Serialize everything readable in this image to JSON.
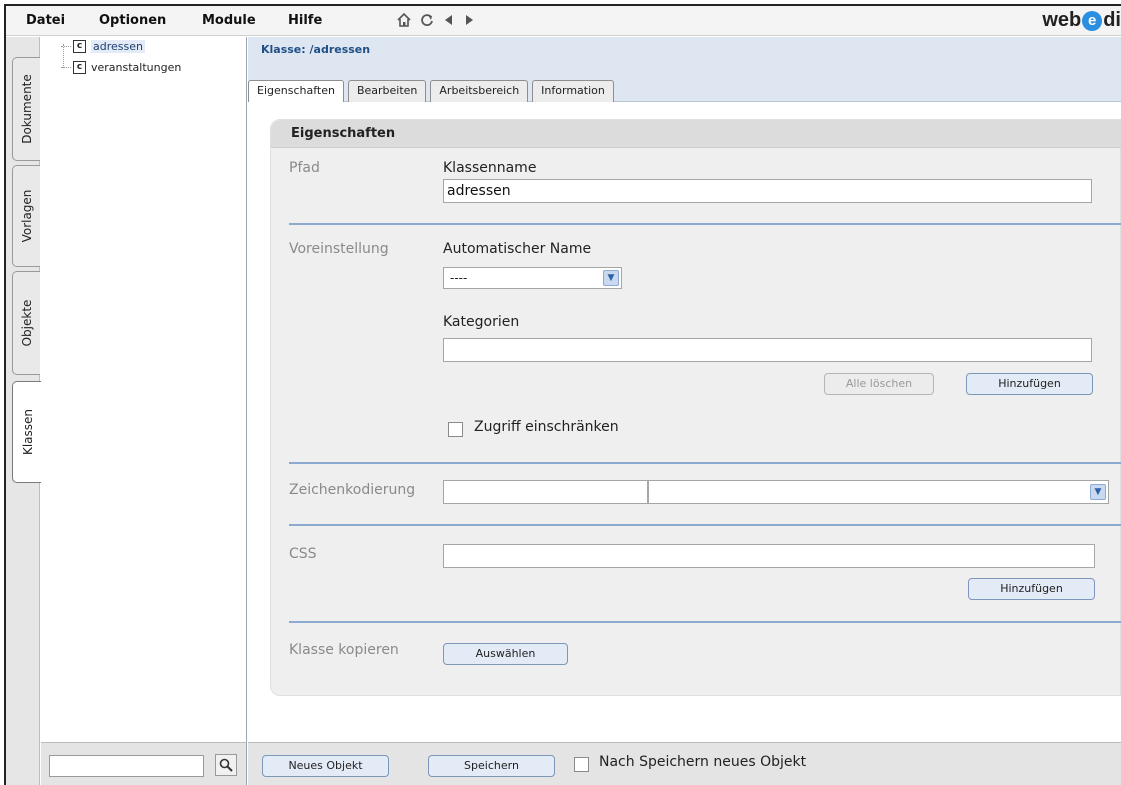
{
  "menu": {
    "items": [
      "Datei",
      "Optionen",
      "Module",
      "Hilfe"
    ],
    "toolbar_icons": [
      "home-icon",
      "reload-icon",
      "back-icon",
      "forward-icon"
    ]
  },
  "brand": {
    "prefix": "web",
    "mark": "e",
    "suffix": "di"
  },
  "side_tabs": [
    "Dokumente",
    "Vorlagen",
    "Objekte",
    "Klassen"
  ],
  "tree": {
    "items": [
      {
        "icon": "c",
        "label": "adressen",
        "selected": true
      },
      {
        "icon": "c",
        "label": "veranstaltungen",
        "selected": false
      }
    ],
    "search_value": ""
  },
  "content": {
    "class_title": "Klasse: /adressen",
    "tabs": [
      "Eigenschaften",
      "Bearbeiten",
      "Arbeitsbereich",
      "Information"
    ],
    "active_tab": "Eigenschaften"
  },
  "panel": {
    "title": "Eigenschaften",
    "path": {
      "section_label": "Pfad",
      "field_label": "Klassenname",
      "field_value": "adressen"
    },
    "defaults": {
      "section_label": "Voreinstellung",
      "auto_name_label": "Automatischer Name",
      "auto_name_value": "----",
      "categories_label": "Kategorien",
      "categories_value": "",
      "clear_all_label": "Alle löschen",
      "add_label": "Hinzufügen",
      "restrict_label": "Zugriff einschränken"
    },
    "encoding": {
      "section_label": "Zeichenkodierung",
      "text_value": "",
      "select_value": ""
    },
    "css": {
      "section_label": "CSS",
      "value": "",
      "add_label": "Hinzufügen"
    },
    "copy": {
      "section_label": "Klasse kopieren",
      "select_label": "Auswählen"
    }
  },
  "bottom": {
    "new_object_label": "Neues Objekt",
    "save_label": "Speichern",
    "after_save_label": "Nach Speichern neues Objekt"
  }
}
